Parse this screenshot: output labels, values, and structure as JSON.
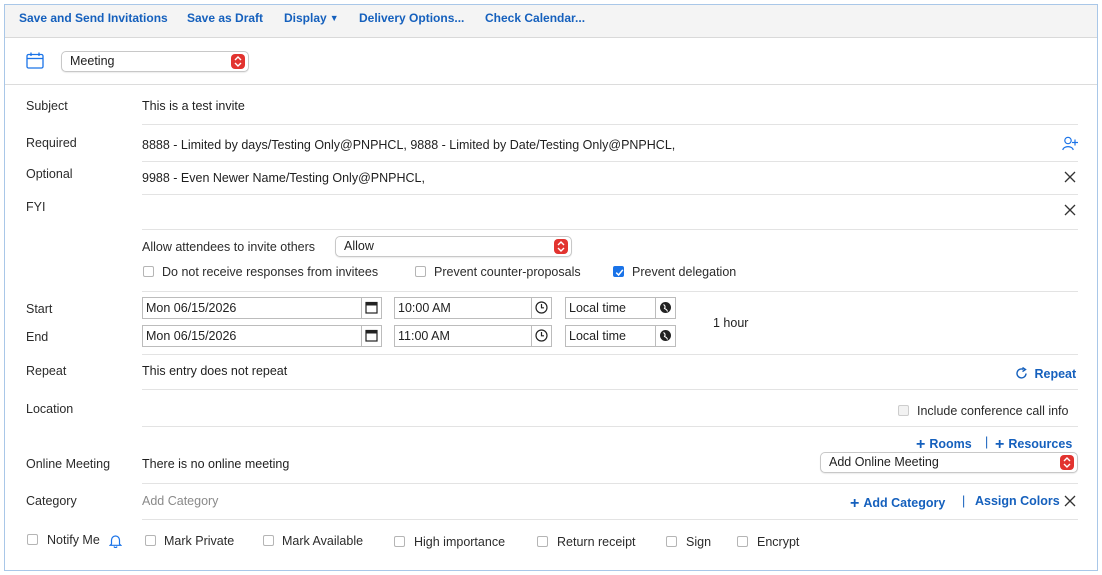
{
  "toolbar": {
    "save_send": "Save and Send Invitations",
    "save_draft": "Save as Draft",
    "display": "Display",
    "delivery": "Delivery Options...",
    "calendar": "Check Calendar..."
  },
  "entry_type": {
    "selected": "Meeting"
  },
  "subject": {
    "label": "Subject",
    "value": "This is a test invite"
  },
  "required": {
    "label": "Required",
    "value": "8888 - Limited by days/Testing Only@PNPHCL, 9888 - Limited by Date/Testing Only@PNPHCL,"
  },
  "optional": {
    "label": "Optional",
    "value": "9988 - Even Newer Name/Testing Only@PNPHCL,"
  },
  "fyi": {
    "label": "FYI",
    "value": ""
  },
  "invite_others": {
    "label": "Allow attendees to invite others",
    "selected": "Allow"
  },
  "options": {
    "no_responses": "Do not receive responses from invitees",
    "prevent_counter": "Prevent counter-proposals",
    "prevent_delegation": "Prevent delegation",
    "prevent_delegation_checked": true
  },
  "start": {
    "label": "Start",
    "date": "Mon 06/15/2026",
    "time": "10:00 AM",
    "zone": "Local time"
  },
  "end": {
    "label": "End",
    "date": "Mon 06/15/2026",
    "time": "11:00 AM",
    "zone": "Local time"
  },
  "duration": "1 hour",
  "repeat": {
    "label": "Repeat",
    "value": "This entry does not repeat",
    "link": "Repeat"
  },
  "location": {
    "label": "Location",
    "conference": "Include conference call info",
    "rooms": "Rooms",
    "divider": "|",
    "resources": "Resources"
  },
  "online": {
    "label": "Online Meeting",
    "value": "There is no online meeting",
    "selected": "Add Online Meeting"
  },
  "category": {
    "label": "Category",
    "placeholder": "Add Category",
    "add": "Add Category",
    "divider": "|",
    "assign": "Assign Colors"
  },
  "flags": {
    "notify": "Notify Me",
    "private": "Mark Private",
    "available": "Mark Available",
    "importance": "High importance",
    "receipt": "Return receipt",
    "sign": "Sign",
    "encrypt": "Encrypt"
  },
  "colors": {
    "link": "#1560bd",
    "accent": "#1a73e8",
    "select_arrow": "#e2332f"
  }
}
